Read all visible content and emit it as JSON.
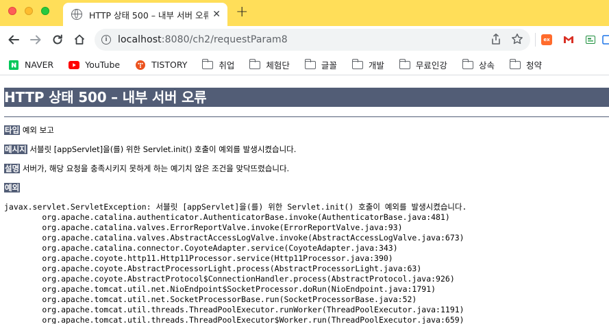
{
  "browser": {
    "tab_title": "HTTP 상태 500 – 내부 서버 오류",
    "tab_close": "✕",
    "new_tab": "+",
    "url_host": "localhost",
    "url_path": ":8080/ch2/requestParam8",
    "bookmarks": [
      {
        "label": "NAVER",
        "icon": "naver-icon"
      },
      {
        "label": "YouTube",
        "icon": "youtube-icon"
      },
      {
        "label": "TISTORY",
        "icon": "tistory-icon"
      },
      {
        "label": "취업",
        "icon": "folder-icon"
      },
      {
        "label": "체험단",
        "icon": "folder-icon"
      },
      {
        "label": "글꼴",
        "icon": "folder-icon"
      },
      {
        "label": "개발",
        "icon": "folder-icon"
      },
      {
        "label": "무료인강",
        "icon": "folder-icon"
      },
      {
        "label": "상속",
        "icon": "folder-icon"
      },
      {
        "label": "청약",
        "icon": "folder-icon"
      }
    ],
    "colors": {
      "tabbar": "#ffde59",
      "accent": "#525d76"
    }
  },
  "page": {
    "heading": "HTTP 상태 500 – 내부 서버 오류",
    "type_label": "타입",
    "type_value": "예외 보고",
    "message_label": "메시지",
    "message_value": "서블릿 [appServlet]을(를) 위한 Servlet.init() 호출이 예외를 발생시켰습니다.",
    "description_label": "설명",
    "description_value": "서버가, 해당 요청을 충족시키지 못하게 하는 예기치 않은 조건을 맞닥뜨렸습니다.",
    "exception_label": "예외",
    "stack_trace": [
      "javax.servlet.ServletException: 서블릿 [appServlet]을(를) 위한 Servlet.init() 호출이 예외를 발생시켰습니다.",
      "\torg.apache.catalina.authenticator.AuthenticatorBase.invoke(AuthenticatorBase.java:481)",
      "\torg.apache.catalina.valves.ErrorReportValve.invoke(ErrorReportValve.java:93)",
      "\torg.apache.catalina.valves.AbstractAccessLogValve.invoke(AbstractAccessLogValve.java:673)",
      "\torg.apache.catalina.connector.CoyoteAdapter.service(CoyoteAdapter.java:343)",
      "\torg.apache.coyote.http11.Http11Processor.service(Http11Processor.java:390)",
      "\torg.apache.coyote.AbstractProcessorLight.process(AbstractProcessorLight.java:63)",
      "\torg.apache.coyote.AbstractProtocol$ConnectionHandler.process(AbstractProtocol.java:926)",
      "\torg.apache.tomcat.util.net.NioEndpoint$SocketProcessor.doRun(NioEndpoint.java:1791)",
      "\torg.apache.tomcat.util.net.SocketProcessorBase.run(SocketProcessorBase.java:52)",
      "\torg.apache.tomcat.util.threads.ThreadPoolExecutor.runWorker(ThreadPoolExecutor.java:1191)",
      "\torg.apache.tomcat.util.threads.ThreadPoolExecutor$Worker.run(ThreadPoolExecutor.java:659)"
    ]
  }
}
